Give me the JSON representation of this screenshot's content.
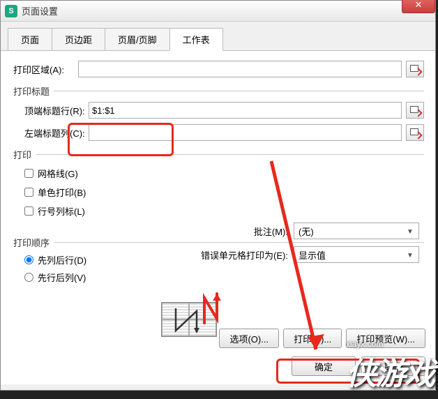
{
  "window": {
    "title": "页面设置"
  },
  "tabs": [
    "页面",
    "页边距",
    "页眉/页脚",
    "工作表"
  ],
  "active_tab": 3,
  "print_area": {
    "label": "打印区域(A):",
    "value": ""
  },
  "print_titles": {
    "section": "打印标题",
    "top_row_label": "顶端标题行(R):",
    "top_row_value": "$1:$1",
    "left_col_label": "左端标题列(C):",
    "left_col_value": ""
  },
  "print": {
    "section": "打印",
    "gridlines": "网格线(G)",
    "bw": "单色打印(B)",
    "rowcol": "行号列标(L)",
    "comments_label": "批注(M):",
    "comments_value": "(无)",
    "errors_label": "错误单元格打印为(E):",
    "errors_value": "显示值"
  },
  "order": {
    "section": "打印顺序",
    "down_over": "先列后行(D)",
    "over_down": "先行后列(V)"
  },
  "buttons": {
    "options": "选项(O)...",
    "print": "打印(P)...",
    "preview": "打印预览(W)...",
    "ok": "确定",
    "cancel": "取消"
  },
  "watermark": {
    "url": "xiayx.com",
    "logo": "侠游戏"
  }
}
